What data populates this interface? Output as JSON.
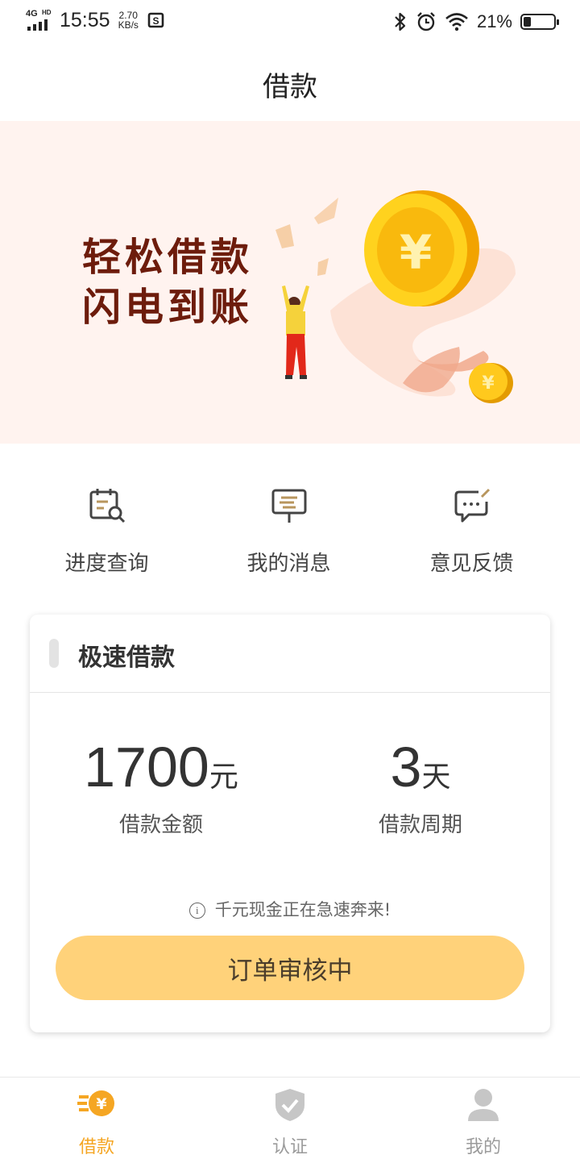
{
  "status_bar": {
    "network": "4G",
    "network_hd": "HD",
    "time": "15:55",
    "speed_value": "2.70",
    "speed_unit": "KB/s",
    "battery_percent": "21%",
    "battery_level": 0.21
  },
  "header": {
    "title": "借款"
  },
  "banner": {
    "line1": "轻松借款",
    "line2": "闪电到账",
    "coin_symbol": "¥"
  },
  "quick_actions": [
    {
      "label": "进度查询",
      "icon": "calendar-search-icon"
    },
    {
      "label": "我的消息",
      "icon": "signpost-icon"
    },
    {
      "label": "意见反馈",
      "icon": "chat-edit-icon"
    }
  ],
  "loan_card": {
    "title": "极速借款",
    "amount": "1700",
    "amount_unit": "元",
    "amount_label": "借款金额",
    "period": "3",
    "period_unit": "天",
    "period_label": "借款周期",
    "tip_icon": "i",
    "tip": "千元现金正在急速奔来!",
    "button_label": "订单审核中"
  },
  "tabs": [
    {
      "label": "借款",
      "icon": "yen-coin-icon",
      "active": true
    },
    {
      "label": "认证",
      "icon": "shield-check-icon",
      "active": false
    },
    {
      "label": "我的",
      "icon": "user-icon",
      "active": false
    }
  ],
  "colors": {
    "accent": "#f5a623",
    "button": "#ffd27a",
    "banner_bg": "#fff3ef",
    "slogan": "#6d1c0c"
  }
}
